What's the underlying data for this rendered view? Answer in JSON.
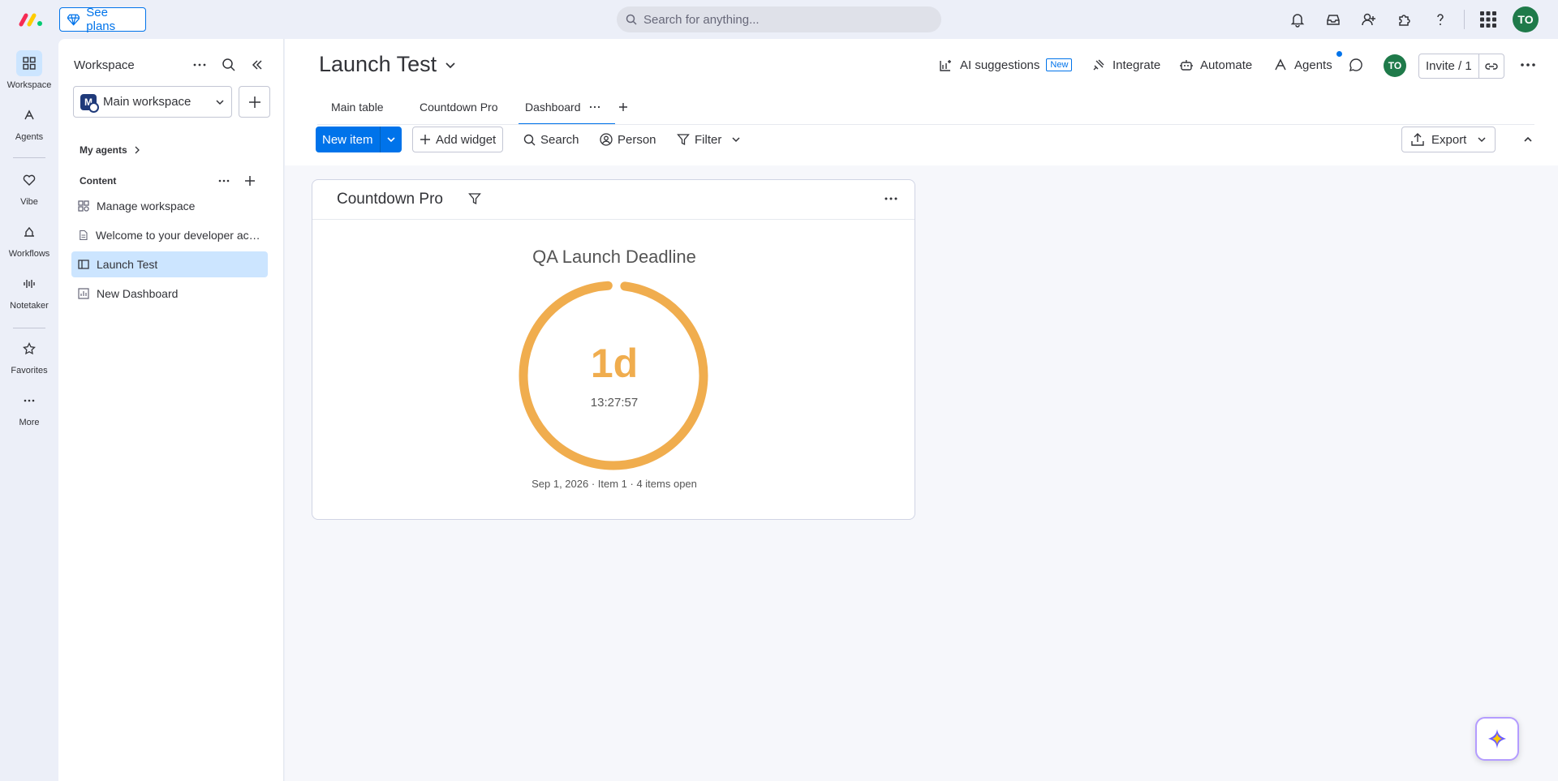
{
  "topbar": {
    "see_plans": "See plans",
    "search_placeholder": "Search for anything...",
    "avatar": "TO"
  },
  "rail": {
    "items": [
      {
        "label": "Workspace"
      },
      {
        "label": "Agents"
      },
      {
        "label": "Vibe"
      },
      {
        "label": "Workflows"
      },
      {
        "label": "Notetaker"
      },
      {
        "label": "Favorites"
      },
      {
        "label": "More"
      }
    ]
  },
  "workspace_panel": {
    "title": "Workspace",
    "selected_workspace": "Main workspace",
    "workspace_initial": "M",
    "my_agents": "My agents",
    "content_label": "Content",
    "items": [
      {
        "label": "Manage workspace"
      },
      {
        "label": "Welcome to your developer account"
      },
      {
        "label": "Launch Test"
      },
      {
        "label": "New Dashboard"
      }
    ]
  },
  "board": {
    "title": "Launch Test",
    "ai_suggestions": "AI suggestions",
    "new_badge": "New",
    "integrate": "Integrate",
    "automate": "Automate",
    "agents": "Agents",
    "avatar": "TO",
    "invite": "Invite / 1",
    "tabs": [
      {
        "label": "Main table"
      },
      {
        "label": "Countdown Pro"
      },
      {
        "label": "Dashboard"
      }
    ]
  },
  "toolbar": {
    "new_item": "New item",
    "add_widget": "Add widget",
    "search": "Search",
    "person": "Person",
    "filter": "Filter",
    "export": "Export"
  },
  "widget": {
    "title": "Countdown Pro",
    "countdown_title": "QA Launch Deadline",
    "days": "1d",
    "time": "13:27:57",
    "footer": "Sep 1, 2026 · Item 1 · 4 items open",
    "ring_color": "#f0ad4e",
    "ring_fill_fraction": 0.97
  },
  "colors": {
    "accent": "#0073ea",
    "countdown": "#f0ad4e",
    "avatar": "#1f7a4a"
  }
}
